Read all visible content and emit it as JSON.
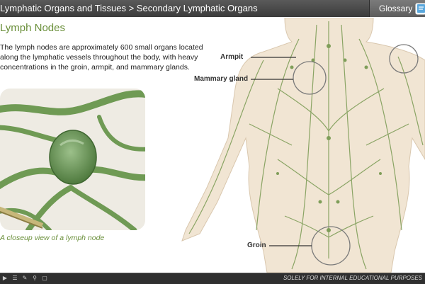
{
  "header": {
    "breadcrumb": "Lymphatic Organs and Tissues > Secondary Lymphatic Organs",
    "glossary_label": "Glossary",
    "glossary_icon": "book-icon"
  },
  "content": {
    "title": "Lymph Nodes",
    "description": "The lymph nodes are approximately 600 small organs located along the lymphatic vessels throughout the body, with heavy concentrations in the groin, armpit, and mammary glands.",
    "caption": "A closeup view of a lymph node"
  },
  "figure": {
    "labels": {
      "armpit": "Armpit",
      "mammary": "Mammary gland",
      "groin": "Groin"
    }
  },
  "footer": {
    "controls": [
      "play-icon",
      "menu-icon",
      "edit-icon",
      "zoom-icon",
      "window-icon"
    ],
    "notice": "SOLELY FOR INTERNAL EDUCATIONAL PURPOSES"
  },
  "colors": {
    "accent_green": "#6a8f3a",
    "vessel_green": "#7f9e59",
    "skin": "#f1e5d3",
    "bar_dark": "#3b3b3b"
  }
}
